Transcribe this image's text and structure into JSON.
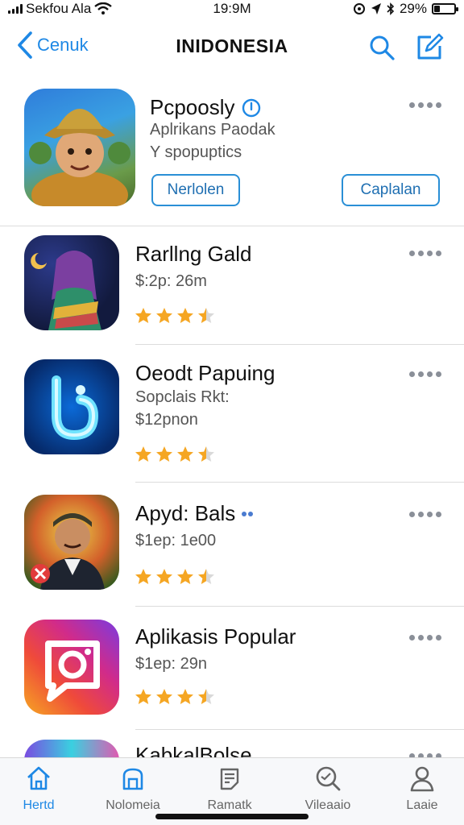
{
  "status_bar": {
    "carrier": "Sekfou Ala",
    "time": "19:9M",
    "battery": "29%",
    "battery_level": 0.29
  },
  "nav": {
    "back_label": "Cenuk",
    "title": "INIDONESIA",
    "search_icon": "search-icon",
    "compose_icon": "compose-icon"
  },
  "featured": {
    "name": "Pcpoosly",
    "subtitle": "Aplrikans Paodak",
    "caption": "Y spopuptics",
    "left_button": "Nerlolen",
    "right_button": "Caplalan"
  },
  "apps": [
    {
      "name": "Rarllng Gald",
      "price": "$:2p: 26m",
      "rating": 3.5
    },
    {
      "name": "Oeodt Papuing",
      "subtitle": "Sopclais Rkt:",
      "price": "$12pnon",
      "rating": 3.5
    },
    {
      "name": "Apyd: Bals",
      "price": "$1ep: 1e00",
      "rating": 3.5
    },
    {
      "name": "Aplikasis Popular",
      "price": "$1ep: 29n",
      "rating": 3.5
    },
    {
      "name": "KabkalBolse"
    }
  ],
  "tabs": [
    {
      "label": "Hertd",
      "icon": "home-icon",
      "active": true
    },
    {
      "label": "Nolomeia",
      "icon": "arch-icon",
      "active": false
    },
    {
      "label": "Ramatk",
      "icon": "clipboard-icon",
      "active": false
    },
    {
      "label": "Vileaaio",
      "icon": "magnifier-chat-icon",
      "active": false
    },
    {
      "label": "Laaie",
      "icon": "person-icon",
      "active": false
    }
  ],
  "colors": {
    "accent": "#1e88e5",
    "star": "#f5a623",
    "star_empty": "#d9d9d9"
  }
}
